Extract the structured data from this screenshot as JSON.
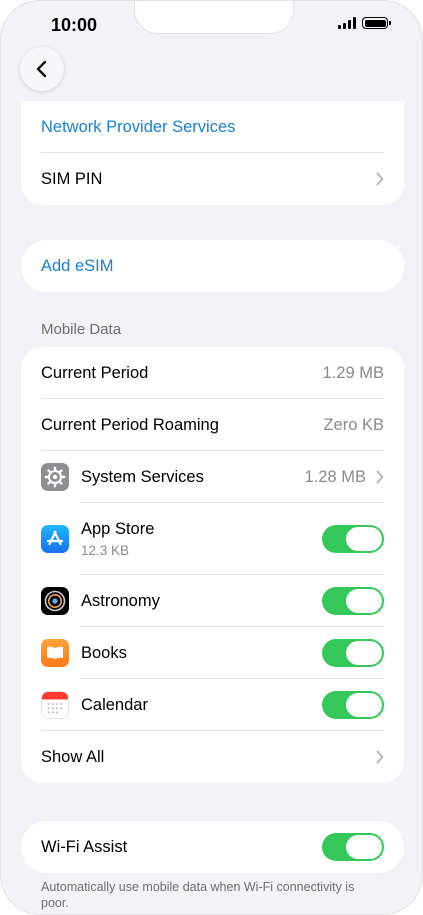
{
  "status_bar": {
    "time": "10:00"
  },
  "top_group": {
    "network_provider_services": "Network Provider Services",
    "sim_pin": "SIM PIN"
  },
  "esim": {
    "add_esim": "Add eSIM"
  },
  "mobile_data": {
    "header": "Mobile Data",
    "current_period": {
      "label": "Current Period",
      "value": "1.29 MB"
    },
    "current_period_roaming": {
      "label": "Current Period Roaming",
      "value": "Zero KB"
    },
    "system_services": {
      "label": "System Services",
      "value": "1.28 MB",
      "icon": "gear-icon"
    },
    "apps": [
      {
        "label": "App Store",
        "sub": "12.3 KB",
        "icon": "app-store-icon",
        "enabled": true
      },
      {
        "label": "Astronomy",
        "icon": "astronomy-icon",
        "enabled": true
      },
      {
        "label": "Books",
        "icon": "books-icon",
        "enabled": true
      },
      {
        "label": "Calendar",
        "icon": "calendar-icon",
        "enabled": true
      }
    ],
    "show_all": "Show All"
  },
  "wifi_assist": {
    "label": "Wi-Fi Assist",
    "enabled": true,
    "footer": "Automatically use mobile data when Wi-Fi connectivity is poor."
  },
  "colors": {
    "link": "#1a7fd6",
    "toggle_on": "#34c759",
    "background": "#f2f2f7"
  }
}
